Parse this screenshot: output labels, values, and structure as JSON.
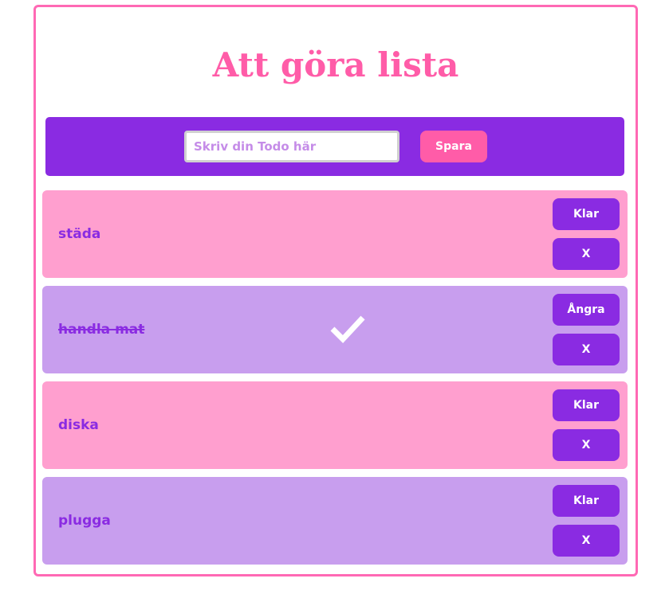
{
  "app": {
    "title": "Att göra lista"
  },
  "form": {
    "input_value": "",
    "input_placeholder": "Skriv din Todo här",
    "save_label": "Spara"
  },
  "todos": [
    {
      "text": "städa",
      "done": false,
      "toggle_label": "Klar",
      "delete_label": "X"
    },
    {
      "text": "handla mat",
      "done": true,
      "toggle_label": "Ångra",
      "delete_label": "X",
      "icon": "checkmark-icon"
    },
    {
      "text": "diska",
      "done": false,
      "toggle_label": "Klar",
      "delete_label": "X"
    },
    {
      "text": "plugga",
      "done": false,
      "toggle_label": "Klar",
      "delete_label": "X"
    }
  ],
  "colors": {
    "accent_purple": "#8a2be2",
    "accent_pink": "#ff5ca8",
    "frame_pink": "#ff69b4",
    "item_pink": "#ff9fcf",
    "item_purple": "#c89eee"
  }
}
